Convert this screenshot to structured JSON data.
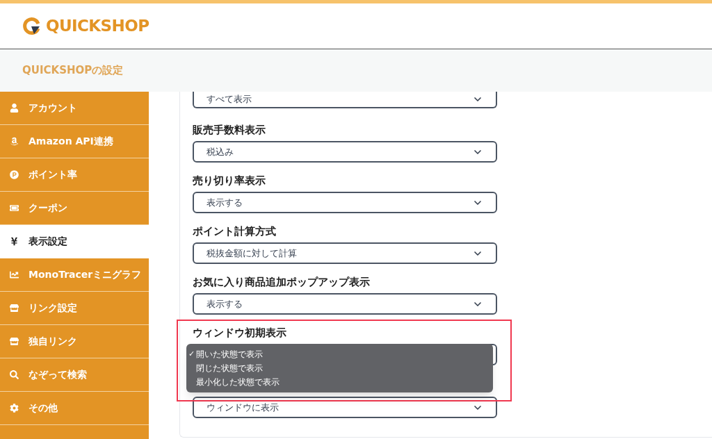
{
  "header": {
    "logo_text": "QUICKSHOP"
  },
  "subheader": {
    "title": "QUICKSHOPの設定"
  },
  "sidebar": {
    "items": [
      {
        "label": "アカウント",
        "selected": false
      },
      {
        "label": "Amazon API連携",
        "selected": false
      },
      {
        "label": "ポイント率",
        "selected": false
      },
      {
        "label": "クーポン",
        "selected": false
      },
      {
        "label": "表示設定",
        "selected": true
      },
      {
        "label": "MonoTracerミニグラフ",
        "selected": false
      },
      {
        "label": "リンク設定",
        "selected": false
      },
      {
        "label": "独自リンク",
        "selected": false
      },
      {
        "label": "なぞって検索",
        "selected": false
      },
      {
        "label": "その他",
        "selected": false
      }
    ]
  },
  "settings": [
    {
      "value": "すべて表示"
    },
    {
      "label": "販売手数料表示",
      "value": "税込み"
    },
    {
      "label": "売り切り率表示",
      "value": "表示する"
    },
    {
      "label": "ポイント計算方式",
      "value": "税抜金額に対して計算"
    },
    {
      "label": "お気に入り商品追加ポップアップ表示",
      "value": "表示する"
    },
    {
      "label": "ウィンドウ初期表示",
      "open": true,
      "check": "✓",
      "options": [
        {
          "label": "開いた状態で表示",
          "selected": true
        },
        {
          "label": "閉じた状態で表示",
          "selected": false
        },
        {
          "label": "最小化した状態で表示",
          "selected": false
        }
      ]
    },
    {
      "value": "ウィンドウに表示"
    }
  ],
  "highlight": {
    "shown": true
  }
}
